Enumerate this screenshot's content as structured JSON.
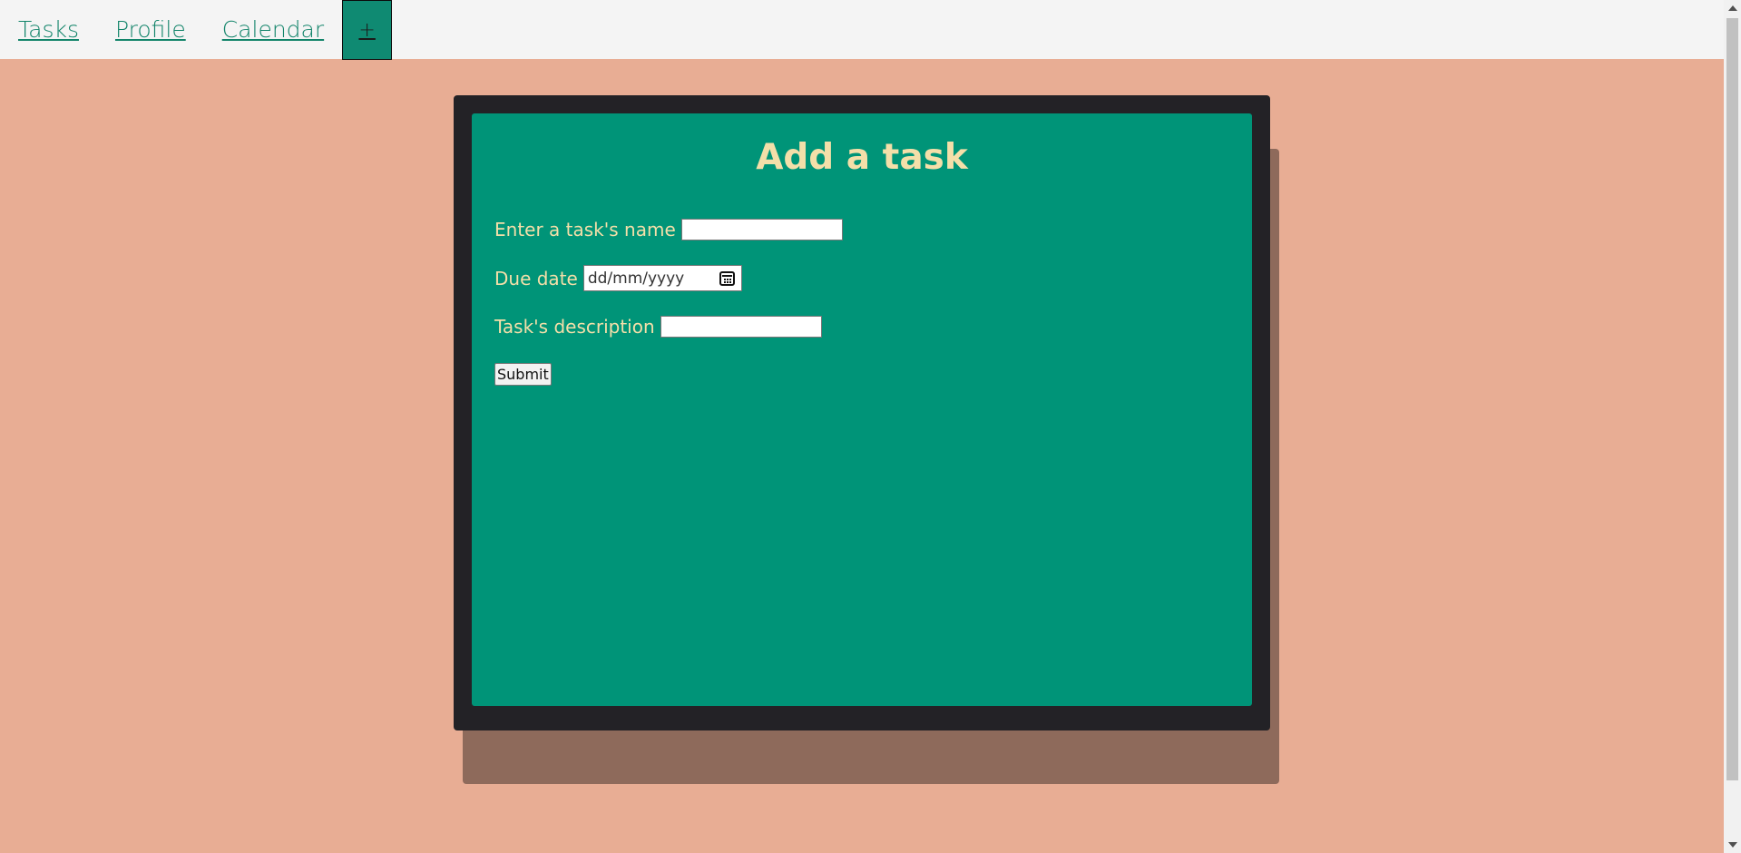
{
  "nav": {
    "tasks": "Tasks",
    "profile": "Profile",
    "calendar": "Calendar",
    "add": "+"
  },
  "form": {
    "title": "Add a task",
    "name_label": "Enter a task's name",
    "due_label": "Due date",
    "due_placeholder": "dd/mm/yyyy",
    "desc_label": "Task's description",
    "submit": "Submit"
  },
  "colors": {
    "page_bg": "#e8ad94",
    "nav_bg": "#f4f4f4",
    "link": "#12846a",
    "frame": "#232226",
    "card": "#009478",
    "text": "#f4dfa9"
  }
}
